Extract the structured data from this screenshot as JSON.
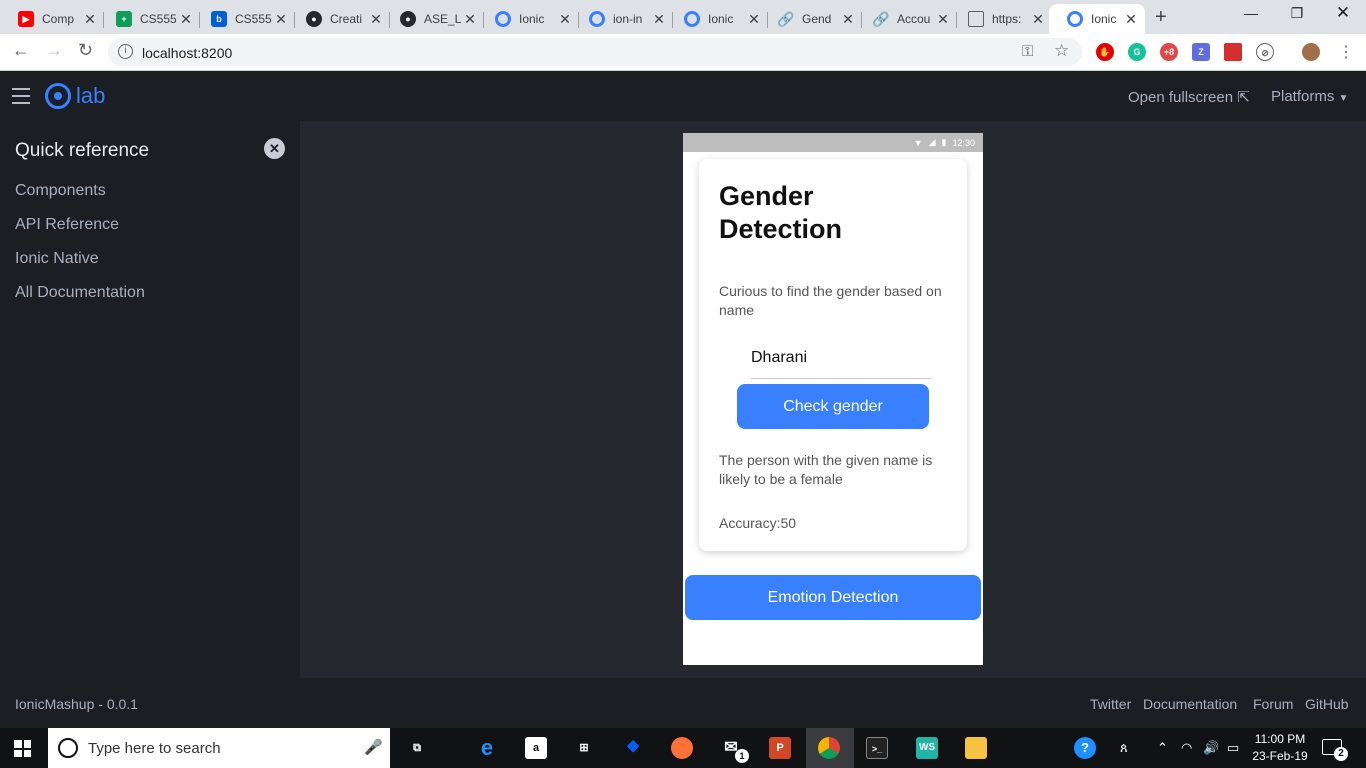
{
  "browser": {
    "tabs": [
      {
        "title": "Comp",
        "favicon": "youtube-icon",
        "color": "#ff0000"
      },
      {
        "title": "CS555",
        "favicon": "sheets-icon",
        "color": "#0f9d58"
      },
      {
        "title": "CS555",
        "favicon": "box-icon",
        "color": "#0061d5"
      },
      {
        "title": "Creati",
        "favicon": "github-icon",
        "color": "#24292e"
      },
      {
        "title": "ASE_L",
        "favicon": "github-icon",
        "color": "#24292e"
      },
      {
        "title": "Ionic",
        "favicon": "ionic-icon",
        "color": "#3880ff"
      },
      {
        "title": "ion-in",
        "favicon": "ionic-icon",
        "color": "#3880ff"
      },
      {
        "title": "Ionic",
        "favicon": "ionic-icon",
        "color": "#3880ff"
      },
      {
        "title": "Gend",
        "favicon": "link-icon",
        "color": "#1a73e8"
      },
      {
        "title": "Accou",
        "favicon": "link-icon",
        "color": "#1a73e8"
      },
      {
        "title": "https:",
        "favicon": "page-icon",
        "color": "#5f6368"
      },
      {
        "title": "Ionic",
        "favicon": "ionic-icon",
        "color": "#3880ff",
        "active": true
      }
    ],
    "url": "localhost:8200"
  },
  "lab": {
    "logo_text": "lab",
    "open_fullscreen": "Open fullscreen",
    "platforms": "Platforms"
  },
  "sidebar": {
    "title": "Quick reference",
    "items": [
      "Components",
      "API Reference",
      "Ionic Native",
      "All Documentation"
    ]
  },
  "footer": {
    "version": "IonicMashup - 0.0.1",
    "links": [
      "Twitter",
      "Documentation",
      "Forum",
      "GitHub"
    ]
  },
  "device": {
    "time": "12:30",
    "card": {
      "title": "Gender Detection",
      "subtitle": "Curious to find the gender based on name",
      "name_value": "Dharani",
      "check_button": "Check gender",
      "result": "The person with the given name is likely to be a female",
      "accuracy": "Accuracy:50"
    },
    "emotion_button": "Emotion Detection"
  },
  "taskbar": {
    "search_placeholder": "Type here to search",
    "time": "11:00 PM",
    "date": "23-Feb-19",
    "notification_count": "2",
    "mail_badge": "1"
  },
  "colors": {
    "accent": "#3880ff",
    "lab_bg": "#25282e",
    "sidebar_bg": "#1b1e23"
  }
}
